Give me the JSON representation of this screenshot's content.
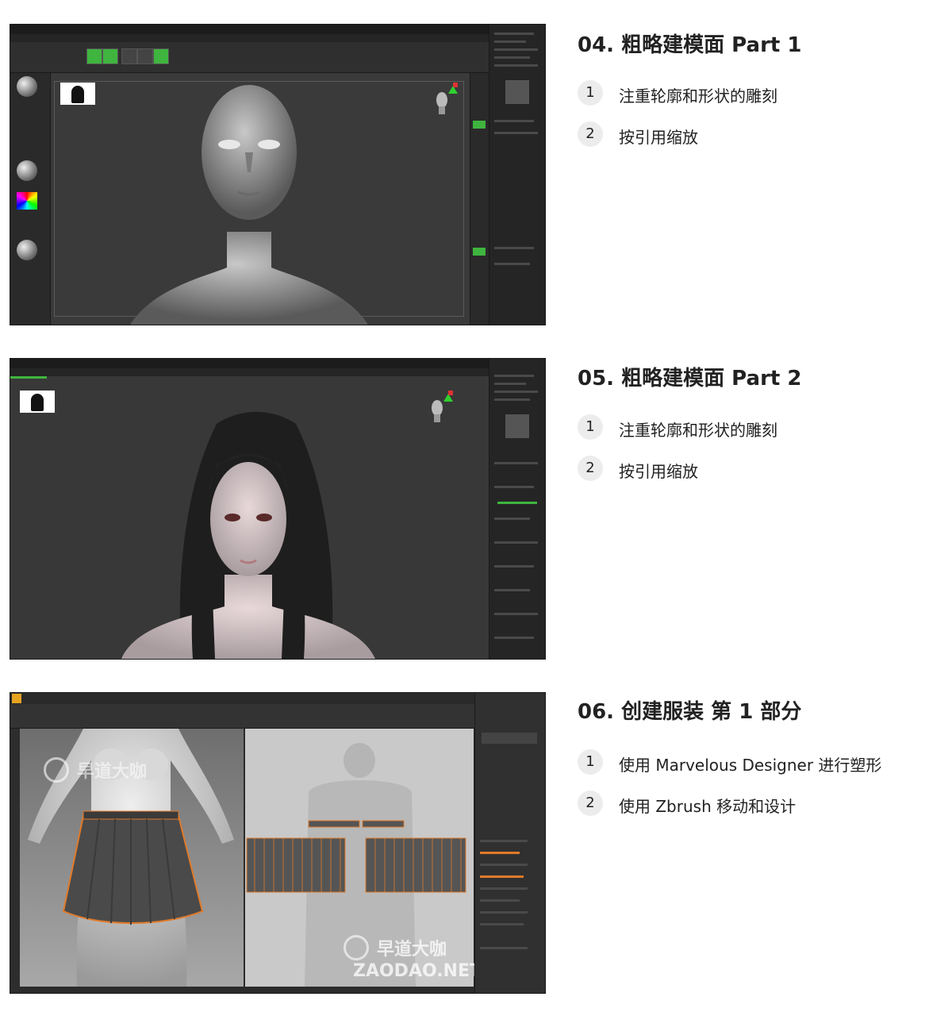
{
  "sections": [
    {
      "heading": "04. 粗略建模面 Part 1",
      "items": [
        {
          "num": "1",
          "text": "注重轮廓和形状的雕刻"
        },
        {
          "num": "2",
          "text": "按引用缩放"
        }
      ]
    },
    {
      "heading": "05. 粗略建模面 Part 2",
      "items": [
        {
          "num": "1",
          "text": "注重轮廓和形状的雕刻"
        },
        {
          "num": "2",
          "text": "按引用缩放"
        }
      ]
    },
    {
      "heading": "06. 创建服装 第 1 部分",
      "items": [
        {
          "num": "1",
          "text": "使用 Marvelous Designer 进行塑形"
        },
        {
          "num": "2",
          "text": "使用 Zbrush 移动和设计"
        }
      ]
    }
  ],
  "watermark": {
    "name": "早道大咖",
    "domain": "ZAODAO.NET"
  },
  "colors": {
    "zbrush_green": "#3fb53f",
    "md_orange": "#e07a2a",
    "text": "#222222",
    "badge": "#ececec"
  }
}
